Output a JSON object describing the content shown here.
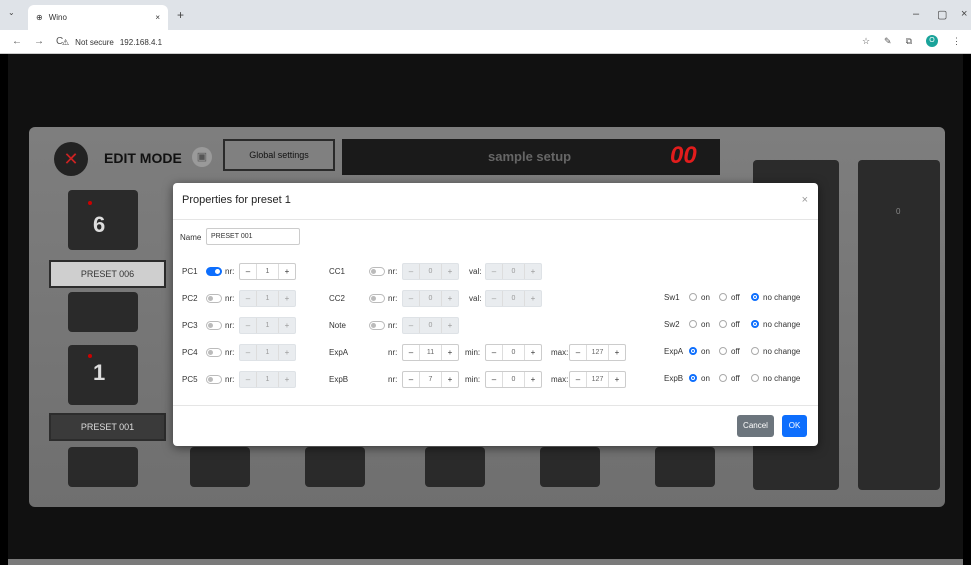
{
  "browser": {
    "tab_title": "Wino",
    "tab_close": "×",
    "new_tab": "+",
    "address_warning": "Not secure",
    "url": "192.168.4.1",
    "back": "←",
    "forward": "→",
    "reload": "C",
    "window_minimize": "–",
    "window_maximize": "▢",
    "window_close": "×",
    "profile_initial": "O"
  },
  "board": {
    "mode_label": "EDIT MODE",
    "global_settings": "Global settings",
    "setup_name": "sample setup",
    "preset_number": "00",
    "preset_top_label": "PRESET 006",
    "preset_top_number": "6",
    "preset_bottom_label": "PRESET 001",
    "preset_bottom_number": "1",
    "exp_value": "0"
  },
  "dialog": {
    "title": "Properties for preset 1",
    "close": "×",
    "name_label": "Name",
    "name_value": "PRESET 001",
    "nr_label": "nr:",
    "val_label": "val:",
    "min_label": "min:",
    "max_label": "max:",
    "minus": "–",
    "plus": "+",
    "pc": [
      {
        "label": "PC1",
        "on": true,
        "value": "1"
      },
      {
        "label": "PC2",
        "on": false,
        "value": "1"
      },
      {
        "label": "PC3",
        "on": false,
        "value": "1"
      },
      {
        "label": "PC4",
        "on": false,
        "value": "1"
      },
      {
        "label": "PC5",
        "on": false,
        "value": "1"
      }
    ],
    "cc1": {
      "label": "CC1",
      "nr": "0",
      "val": "0"
    },
    "cc2": {
      "label": "CC2",
      "nr": "0",
      "val": "0"
    },
    "note": {
      "label": "Note",
      "nr": "0"
    },
    "expa": {
      "label": "ExpA",
      "nr": "11",
      "min": "0",
      "max": "127"
    },
    "expb": {
      "label": "ExpB",
      "nr": "7",
      "min": "0",
      "max": "127"
    },
    "radio_on": "on",
    "radio_off": "off",
    "radio_nochange": "no change",
    "switches": [
      {
        "label": "Sw1",
        "selected": "no change"
      },
      {
        "label": "Sw2",
        "selected": "no change"
      },
      {
        "label": "ExpA",
        "selected": "on"
      },
      {
        "label": "ExpB",
        "selected": "on"
      }
    ],
    "cancel": "Cancel",
    "ok": "OK"
  },
  "colors": {
    "primary": "#0d6efd",
    "secondary": "#6c757d",
    "display_red": "#e21c1c"
  }
}
